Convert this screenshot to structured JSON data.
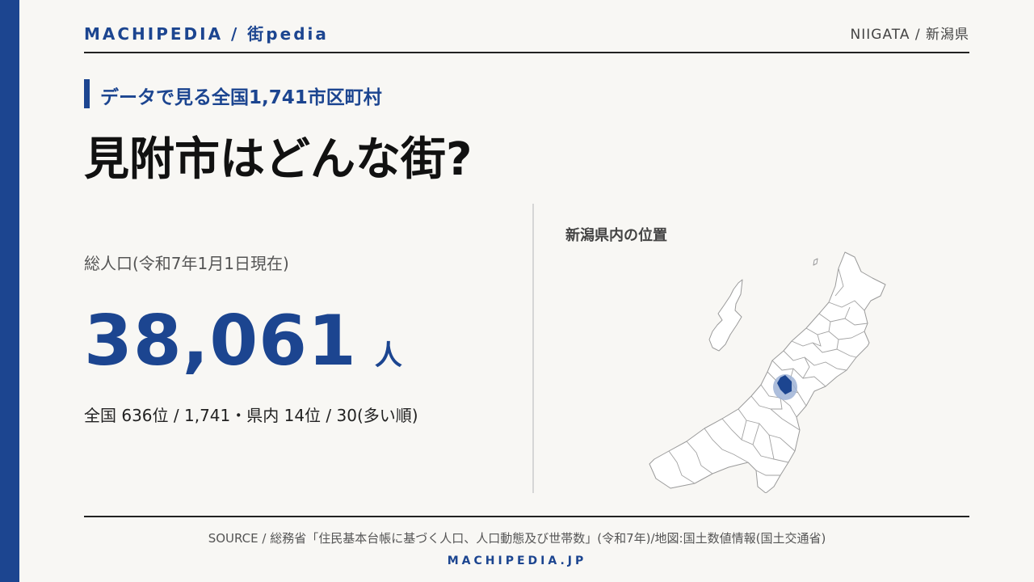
{
  "header": {
    "brand": "MACHIPEDIA / 街pedia",
    "region": "NIIGATA / 新潟県"
  },
  "tagline": "データで見る全国1,741市区町村",
  "headline": "見附市はどんな街?",
  "population": {
    "label": "総人口(令和7年1月1日現在)",
    "value": "38,061",
    "unit": "人",
    "rank": "全国 636位 / 1,741・県内 14位 / 30(多い順)"
  },
  "map": {
    "title": "新潟県内の位置"
  },
  "footer": {
    "source": "SOURCE / 総務省「住民基本台帳に基づく人口、人口動態及び世帯数」(令和7年)/地図:国土数値情報(国土交通省)",
    "site": "MACHIPEDIA.JP"
  },
  "colors": {
    "accent": "#1c4590",
    "highlight_ring": "#9fb3d6",
    "background": "#f8f7f4"
  }
}
